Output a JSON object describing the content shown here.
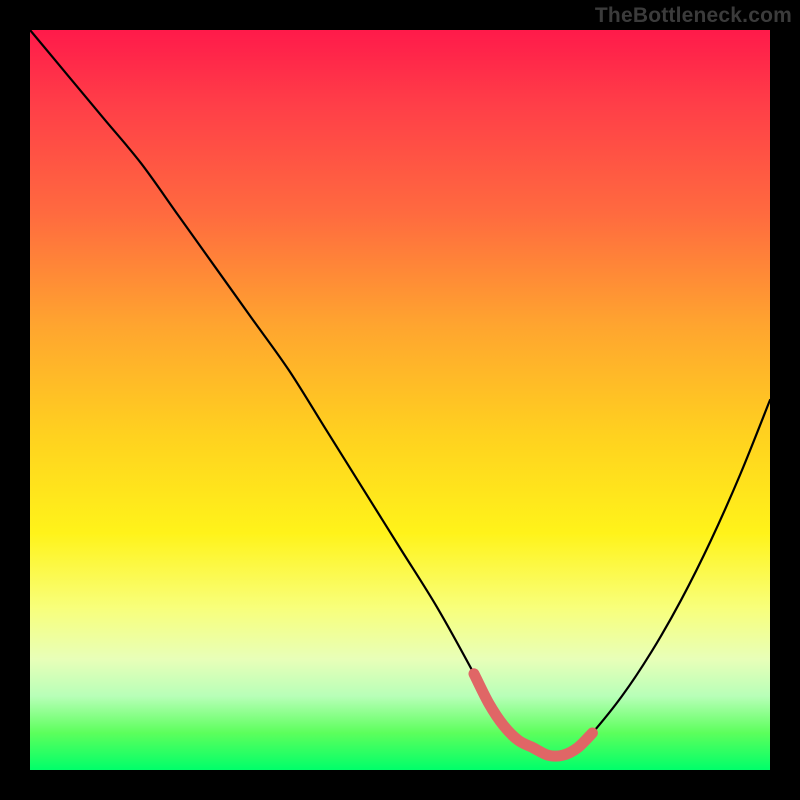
{
  "watermark": "TheBottleneck.com",
  "colors": {
    "curve": "#000000",
    "highlight": "#e06666",
    "frame": "#000000"
  },
  "chart_data": {
    "type": "line",
    "title": "",
    "xlabel": "",
    "ylabel": "",
    "xlim": [
      0,
      100
    ],
    "ylim": [
      0,
      100
    ],
    "grid": false,
    "series": [
      {
        "name": "bottleneck-curve",
        "x": [
          0,
          5,
          10,
          15,
          20,
          25,
          30,
          35,
          40,
          45,
          50,
          55,
          60,
          62,
          64,
          66,
          68,
          70,
          72,
          74,
          76,
          80,
          84,
          88,
          92,
          96,
          100
        ],
        "values": [
          100,
          94,
          88,
          82,
          75,
          68,
          61,
          54,
          46,
          38,
          30,
          22,
          13,
          9,
          6,
          4,
          3,
          2,
          2,
          3,
          5,
          10,
          16,
          23,
          31,
          40,
          50
        ]
      }
    ],
    "highlight_region": {
      "name": "optimal-range",
      "x": [
        60,
        62,
        64,
        66,
        68,
        70,
        72,
        74,
        76
      ],
      "values": [
        13,
        9,
        6,
        4,
        3,
        2,
        2,
        3,
        5
      ]
    }
  }
}
